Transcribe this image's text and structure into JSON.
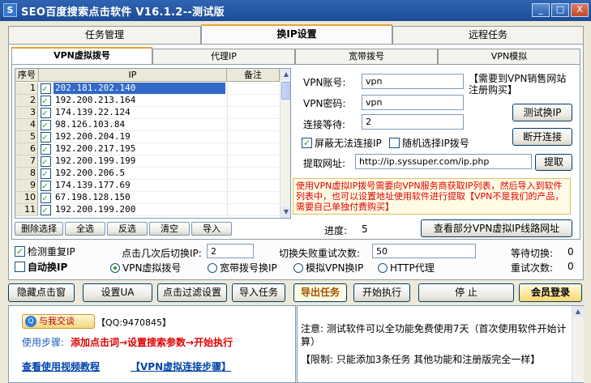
{
  "window": {
    "icon_text": "S",
    "title": "SEO百度搜索点击软件 V16.1.2--测试版",
    "min_label": "_",
    "max_label": "□",
    "close_label": "X"
  },
  "main_tabs": [
    {
      "label": "任务管理",
      "active": false
    },
    {
      "label": "换IP设置",
      "active": true
    },
    {
      "label": "远程任务",
      "active": false
    }
  ],
  "sub_tabs": [
    {
      "label": "VPN虚拟拨号",
      "active": true
    },
    {
      "label": "代理IP",
      "active": false
    },
    {
      "label": "宽带拨号",
      "active": false
    },
    {
      "label": "VPN模拟",
      "active": false
    }
  ],
  "grid": {
    "headers": [
      "序号",
      "IP",
      "备注"
    ],
    "rows": [
      {
        "n": "1",
        "checked": true,
        "ip": "202.181.202.140",
        "selected": true
      },
      {
        "n": "2",
        "checked": true,
        "ip": "192.200.213.164"
      },
      {
        "n": "3",
        "checked": true,
        "ip": "174.139.22.124"
      },
      {
        "n": "4",
        "checked": true,
        "ip": "98.126.103.84"
      },
      {
        "n": "5",
        "checked": true,
        "ip": "192.200.204.19"
      },
      {
        "n": "6",
        "checked": true,
        "ip": "192.200.217.195"
      },
      {
        "n": "7",
        "checked": true,
        "ip": "192.200.199.199"
      },
      {
        "n": "8",
        "checked": true,
        "ip": "192.200.206.5"
      },
      {
        "n": "9",
        "checked": true,
        "ip": "174.139.177.69"
      },
      {
        "n": "10",
        "checked": true,
        "ip": "67.198.128.150"
      },
      {
        "n": "11",
        "checked": true,
        "ip": "192.200.199.200"
      }
    ]
  },
  "grid_buttons": [
    "删除选择",
    "全选",
    "反选",
    "清空",
    "导入"
  ],
  "vpn": {
    "account_label": "VPN账号:",
    "account_value": "vpn",
    "password_label": "VPN密码:",
    "password_value": "vpn",
    "wait_label": "连接等待:",
    "wait_value": "2",
    "buy_note": "【需要到VPN销售网站注册购买】",
    "test_button": "测试换IP",
    "disconnect_button": "断开连接",
    "block_fail_label": "屏蔽无法连接IP",
    "random_label": "随机选择IP拨号",
    "fetch_label": "提取网址:",
    "fetch_url": "http://ip.syssuper.com/ip.php",
    "fetch_button": "提取",
    "notice": "使用VPN虚拟IP拨号需要向VPN服务商获取IP列表，然后导入到软件列表中，也可以设置地址使用软件进行提取【VPN不是我们的产品，需要自己单独付费购买】",
    "progress_label": "进度:",
    "progress_value": "5",
    "view_button": "查看部分VPN虚拟IP线路网址"
  },
  "options": {
    "check_dup_label": "检测重复IP",
    "auto_ip_label": "自动换IP",
    "switch_after_label": "点击几次后切换IP:",
    "switch_after_value": "2",
    "retry_label": "切换失败重试次数:",
    "retry_value": "50",
    "wait_switch_label": "等待切换:",
    "wait_switch_value": "0",
    "retry_count_label": "重试次数:",
    "retry_count_value": "0",
    "radios": [
      {
        "label": "VPN虚拟拨号",
        "selected": true
      },
      {
        "label": "宽带拨号换IP",
        "selected": false
      },
      {
        "label": "模拟VPN换IP",
        "selected": false
      },
      {
        "label": "HTTP代理",
        "selected": false
      }
    ]
  },
  "toolbar": [
    "隐藏点击窗",
    "设置UA",
    "点击过滤设置",
    "导入任务",
    "导出任务",
    "开始执行",
    "停 止",
    "会员登录"
  ],
  "bottom_left": {
    "qq_button": "与我交谈",
    "qq_text": "【QQ:9470845】",
    "steps_label": "使用步骤:",
    "steps_text": "添加点击词→设置搜索参数→开始执行",
    "video_link": "查看使用视频教程",
    "vpn_link": "【VPN虚拟连接步骤】"
  },
  "bottom_right": {
    "note1": "注意: 测试软件可以全功能免费使用7天（首次使用软件开始计算）",
    "note2": "【限制: 只能添加3条任务 其他功能和注册版完全一样】"
  }
}
